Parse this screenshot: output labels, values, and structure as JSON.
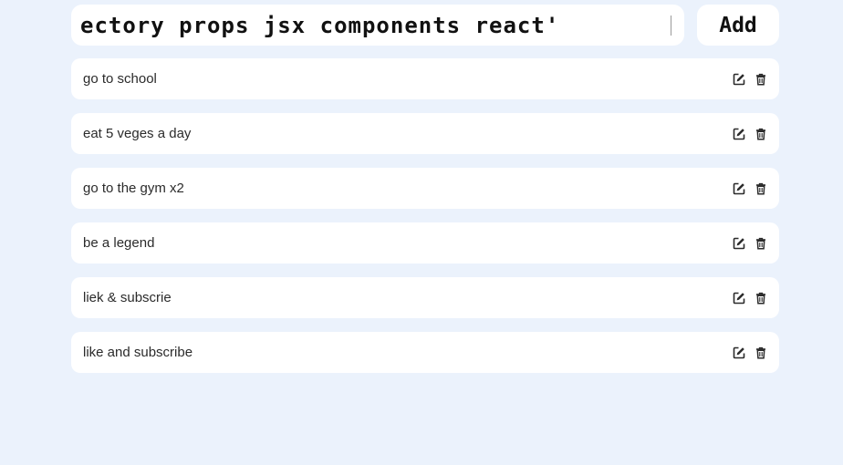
{
  "todo": {
    "input_value": "'ectory props jsx components react",
    "add_label": "Add",
    "items": [
      {
        "text": "go to school"
      },
      {
        "text": "eat 5 veges a day"
      },
      {
        "text": "go to the gym x2"
      },
      {
        "text": "be a legend"
      },
      {
        "text": "liek & subscrie"
      },
      {
        "text": "like and subscribe"
      }
    ]
  },
  "icons": {
    "edit": "edit-icon",
    "delete": "trash-icon"
  },
  "colors": {
    "background": "#ebf2fc",
    "card": "#ffffff",
    "text": "#2b2b2b"
  }
}
